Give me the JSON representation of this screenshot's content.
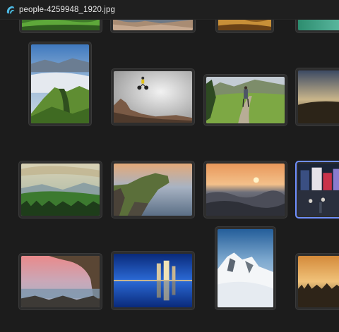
{
  "window": {
    "title": "people-4259948_1920.jpg",
    "app_icon": "photos-app-icon"
  },
  "thumbnails": [
    {
      "name": "thumbnail-green-field-partial",
      "selected": false
    },
    {
      "name": "thumbnail-landscape-partial-2",
      "selected": false
    },
    {
      "name": "thumbnail-landscape-partial-3",
      "selected": false
    },
    {
      "name": "thumbnail-teal-partial",
      "selected": false
    },
    {
      "name": "thumbnail-mountain-ridge",
      "selected": false
    },
    {
      "name": "thumbnail-mountain-biker-jump",
      "selected": false
    },
    {
      "name": "thumbnail-hiker-trail",
      "selected": false
    },
    {
      "name": "thumbnail-sunset-hills-partial",
      "selected": false
    },
    {
      "name": "thumbnail-valley-forest",
      "selected": false
    },
    {
      "name": "thumbnail-sea-cliff",
      "selected": false
    },
    {
      "name": "thumbnail-ocean-sunset",
      "selected": false
    },
    {
      "name": "thumbnail-city-street-night",
      "selected": true
    },
    {
      "name": "thumbnail-sea-cave-sunset",
      "selected": false
    },
    {
      "name": "thumbnail-city-reflection-night",
      "selected": false
    },
    {
      "name": "thumbnail-snowy-mountain",
      "selected": false
    },
    {
      "name": "thumbnail-misty-forest-sunrise",
      "selected": false
    }
  ],
  "colors": {
    "background": "#1c1c1c",
    "tile_background": "#2d2d2d",
    "selection_accent": "#6f8fff"
  }
}
